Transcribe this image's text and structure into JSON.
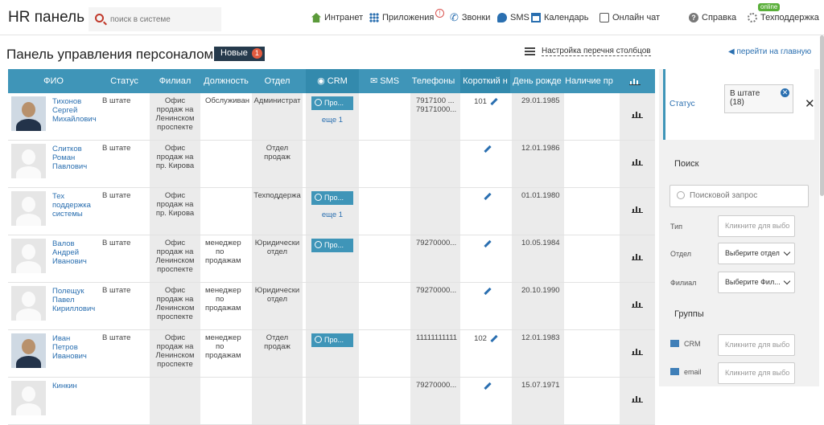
{
  "app": {
    "title": "HR панель"
  },
  "search": {
    "placeholder": "поиск в системе"
  },
  "nav": {
    "intranet": "Интранет",
    "apps": "Приложения",
    "apps_alert": "!",
    "calls": "Звонки",
    "sms": "SMS",
    "calendar": "Календарь",
    "chat": "Онлайн чат",
    "help": "Справка",
    "support": "Техподдержка",
    "online": "online"
  },
  "page": {
    "title": "Панель управления персоналом",
    "new_label": "Новые",
    "new_count": "1",
    "columns_settings": "Настройка перечня столбцов",
    "back_home": "перейти на главную"
  },
  "columns": {
    "fio": "ФИО",
    "status": "Статус",
    "branch": "Филиал",
    "position": "Должность",
    "dept": "Отдел",
    "crm": "CRM",
    "sms": "SMS",
    "phones": "Телефоны",
    "short": "Короткий н",
    "bday": "День рожде",
    "presence": "Наличие пр"
  },
  "rows": [
    {
      "name1": "Тихонов",
      "name2": "Сергей",
      "name3": "Михайлович",
      "status": "В штате",
      "branch1": "Офис",
      "branch2": "продаж на",
      "branch3": "Ленинском",
      "branch4": "проспекте",
      "pos1": "Обслуживан",
      "pos2": "",
      "pos3": "",
      "dept1": "Администрат",
      "dept2": "",
      "crm": "Про...",
      "more": "еще 1",
      "phone1": "7917100 ...",
      "phone2": "79171000...",
      "short": "101",
      "bday": "29.01.1985"
    },
    {
      "name1": "Слитков",
      "name2": "Роман",
      "name3": "Павлович",
      "status": "В штате",
      "branch1": "Офис",
      "branch2": "продаж на",
      "branch3": "пр. Кирова",
      "branch4": "",
      "pos1": "",
      "pos2": "",
      "pos3": "",
      "dept1": "Отдел",
      "dept2": "продаж",
      "crm": "",
      "more": "",
      "phone1": "",
      "phone2": "",
      "short": "",
      "bday": "12.01.1986"
    },
    {
      "name1": "Тех",
      "name2": "поддержка",
      "name3": "системы",
      "status": "В штате",
      "branch1": "Офис",
      "branch2": "продаж на",
      "branch3": "пр. Кирова",
      "branch4": "",
      "pos1": "",
      "pos2": "",
      "pos3": "",
      "dept1": "Техподдержа",
      "dept2": "",
      "crm": "Про...",
      "more": "еще 1",
      "phone1": "",
      "phone2": "",
      "short": "",
      "bday": "01.01.1980"
    },
    {
      "name1": "Валов",
      "name2": "Андрей",
      "name3": "Иванович",
      "status": "В штате",
      "branch1": "Офис",
      "branch2": "продаж на",
      "branch3": "Ленинском",
      "branch4": "проспекте",
      "pos1": "менеджер",
      "pos2": "по",
      "pos3": "продажам",
      "dept1": "Юридически",
      "dept2": "отдел",
      "crm": "Про...",
      "more": "",
      "phone1": "79270000...",
      "phone2": "",
      "short": "",
      "bday": "10.05.1984"
    },
    {
      "name1": "Полещук",
      "name2": "Павел",
      "name3": "Кириллович",
      "status": "В штате",
      "branch1": "Офис",
      "branch2": "продаж на",
      "branch3": "Ленинском",
      "branch4": "проспекте",
      "pos1": "менеджер",
      "pos2": "по",
      "pos3": "продажам",
      "dept1": "Юридически",
      "dept2": "отдел",
      "crm": "",
      "more": "",
      "phone1": "79270000...",
      "phone2": "",
      "short": "",
      "bday": "20.10.1990"
    },
    {
      "name1": "Иван",
      "name2": "Петров",
      "name3": "Иванович",
      "status": "В штате",
      "branch1": "Офис",
      "branch2": "продаж на",
      "branch3": "Ленинском",
      "branch4": "проспекте",
      "pos1": "менеджер",
      "pos2": "по",
      "pos3": "продажам",
      "dept1": "Отдел",
      "dept2": "продаж",
      "crm": "Про...",
      "more": "",
      "phone1": "11111111111",
      "phone2": "",
      "short": "102",
      "bday": "12.01.1983"
    },
    {
      "name1": "Кинкин",
      "name2": "",
      "name3": "",
      "status": "",
      "branch1": "",
      "branch2": "",
      "branch3": "",
      "branch4": "",
      "pos1": "",
      "pos2": "",
      "pos3": "",
      "dept1": "",
      "dept2": "",
      "crm": "",
      "more": "",
      "phone1": "79270000...",
      "phone2": "",
      "short": "",
      "bday": "15.07.1971"
    }
  ],
  "filter": {
    "status_label": "Статус",
    "status_chip": "В штате",
    "status_chip_count": "(18)",
    "close": "✕",
    "search_title": "Поиск",
    "search_placeholder": "Поисковой запрос",
    "type_label": "Тип",
    "type_placeholder": "Кликните для выбо",
    "dept_label": "Отдел",
    "dept_value": "Выберите отдел",
    "branch_label": "Филиал",
    "branch_value": "Выберите Фил...",
    "groups_title": "Группы",
    "crm_label": "CRM",
    "crm_placeholder": "Кликните для выбо",
    "email_label": "email",
    "email_placeholder": "Кликните для выбо"
  }
}
